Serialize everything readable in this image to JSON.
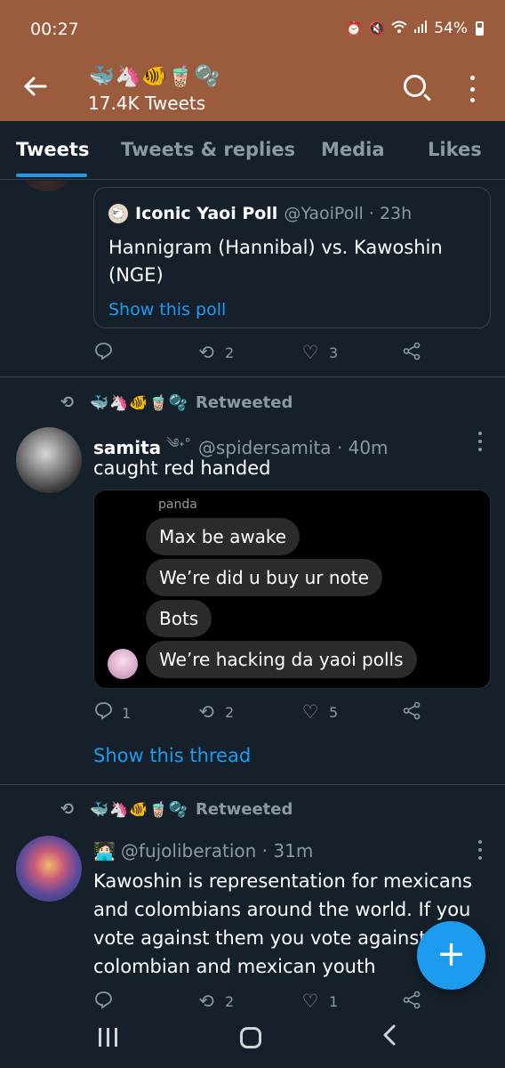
{
  "status_bar": {
    "time": "00:27",
    "icons": [
      "alarm-icon",
      "mute-icon",
      "wifi-icon",
      "signal-icon",
      "battery-icon"
    ],
    "battery": "54%"
  },
  "app_bar": {
    "profile_name_emojis": "🐳🦄🐠🧋🫧",
    "tweet_count": "17.4K Tweets"
  },
  "tabs": [
    {
      "label": "Tweets",
      "active": true
    },
    {
      "label": "Tweets & replies",
      "active": false
    },
    {
      "label": "Media",
      "active": false
    },
    {
      "label": "Likes",
      "active": false
    }
  ],
  "tweets": [
    {
      "quote": {
        "avatar_emoji": "🐑",
        "name": "Iconic Yaoi Poll",
        "meta": "@YaoiPoll · 23h",
        "text": "Hannigram (Hannibal) vs. Kawoshin (NGE)",
        "link": "Show this poll"
      },
      "actions": {
        "replies": "",
        "retweets": "2",
        "likes": "3"
      }
    },
    {
      "retweeted_by": "🐳🦄🐠🧋🫧",
      "retweeted_label": "Retweeted",
      "name": "samita",
      "name_decoration": "༄˖°",
      "meta": "@spidersamita · 40m",
      "text": "caught red handed",
      "media": {
        "sender": "panda",
        "messages": [
          "Max be awake",
          "We’re did u buy ur note",
          "Bots",
          "We’re hacking da yaoi polls"
        ]
      },
      "actions": {
        "replies": "1",
        "retweets": "2",
        "likes": "5"
      },
      "thread_link": "Show this thread"
    },
    {
      "retweeted_by": "🐳🦄🐠🧋🫧",
      "retweeted_label": "Retweeted",
      "name": "🧑🏻‍💻",
      "meta": "@fujoliberation · 31m",
      "text": "Kawoshin is representation for mexicans and colombians around the world. If you vote against them you vote against colombian and mexican youth",
      "actions": {
        "replies": "",
        "retweets": "2",
        "likes": "1"
      }
    }
  ],
  "fab": {
    "label": "+"
  }
}
